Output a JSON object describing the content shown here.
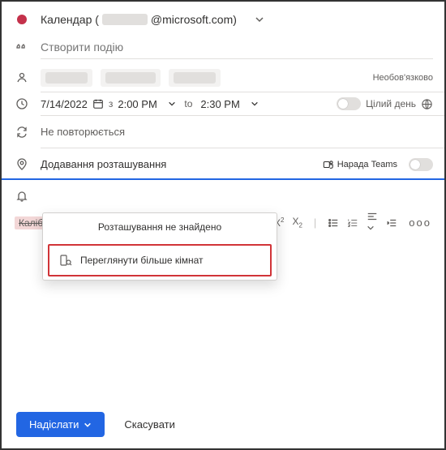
{
  "header": {
    "calendar_prefix": "Календар (",
    "email_suffix": "@microsoft.com)",
    "title_placeholder": "Створити подію",
    "optional_label": "Необов'язково"
  },
  "time": {
    "date": "7/14/2022",
    "separator": "з",
    "start": "2:00 PM",
    "to": "to",
    "end": "2:30 PM",
    "all_day": "Цілий день"
  },
  "recurrence": "Не повторюється",
  "location": {
    "placeholder": "Додавання розташування",
    "teams_label": "Нарада Teams"
  },
  "dropdown": {
    "header": "Розташування не знайдено",
    "more_rooms": "Переглянути більше кімнат"
  },
  "toolbar": {
    "font": "Калібр"
  },
  "footer": {
    "send": "Надіслати",
    "cancel": "Скасувати"
  }
}
